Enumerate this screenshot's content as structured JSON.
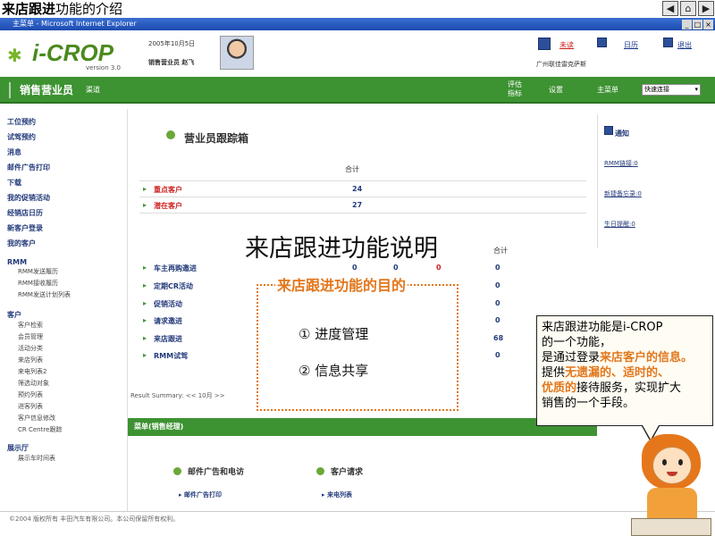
{
  "slide": {
    "title_bold": "来店跟进",
    "title_rest": "功能的介绍",
    "nav_buttons": [
      "◀",
      "⌂",
      "▶"
    ]
  },
  "window": {
    "title": "主菜单 - Microsoft Internet Explorer",
    "controls": [
      "_",
      "□",
      "×"
    ]
  },
  "header": {
    "logo_text": "i-CROP",
    "version": "version 3.0",
    "date": "2005年10月5日",
    "user": "销售营业员 赵飞",
    "links": [
      {
        "label": "未读",
        "icon": "calendar-icon"
      },
      {
        "label": "日历",
        "icon": "calendar-icon"
      },
      {
        "label": "退出",
        "icon": "logout-icon"
      }
    ],
    "dealer": "广州联佳雷克萨斯"
  },
  "navbar": {
    "title": "销售营业员",
    "subtitle": "渠道",
    "items": [
      "评估指标",
      "设置",
      "主菜单"
    ],
    "quick_select": "快速连接"
  },
  "sidebar": {
    "items": [
      "工位预约",
      "试驾预约",
      "消息",
      "邮件广告打印",
      "下载",
      "我的促销活动",
      "经销店日历",
      "新客户登录",
      "我的客户"
    ],
    "rmm_head": "RMM",
    "rmm_items": [
      "RMM发送履历",
      "RMM接收履历",
      "RMM发送计划列表"
    ],
    "customer_head": "客户",
    "customer_items": [
      "客户检索",
      "会员管理",
      "活动分类",
      "来店列表",
      "来电列表2",
      "筛选动对象",
      "预约列表",
      "进客列表",
      "客户信息修改",
      "CR Centre跟踪"
    ],
    "showroom_head": "展示厅",
    "showroom_items": [
      "展示车时间表"
    ]
  },
  "main": {
    "section_title": "营业员跟踪箱",
    "total_label": "合计",
    "rows_top": [
      {
        "label": "重点客户",
        "value": "24"
      },
      {
        "label": "潜在客户",
        "value": "27"
      }
    ],
    "total_label2": "合计",
    "rows_bottom": [
      {
        "label": "车主再购邀进",
        "v1": "0",
        "v2": "0",
        "v3": "0",
        "total": "0"
      },
      {
        "label": "定期CR活动",
        "total": "0"
      },
      {
        "label": "促销活动",
        "total": "0"
      },
      {
        "label": "请求邀进",
        "total": "0"
      },
      {
        "label": "来店跟进",
        "total": "68"
      },
      {
        "label": "RMM试驾",
        "total": "0"
      }
    ],
    "result_summary": "Result Summary:  <<  10月  >>",
    "menu_bar": "菜单(销售经理)",
    "section2_title": "邮件广告和电访",
    "section2_link": "邮件广告打印",
    "section3_title": "客户请求",
    "section3_link": "来电列表"
  },
  "notice": {
    "title": "通知",
    "links": [
      "RMM链接:0",
      "新捷备忘录:0",
      "生日提醒:0"
    ]
  },
  "overlay": {
    "title": "来店跟进功能说明",
    "purpose_title": "来店跟进功能的目的",
    "purposes": [
      "①  进度管理",
      "②  信息共享"
    ]
  },
  "callout": {
    "line1": "来店跟进功能是i-CROP",
    "line2": "的一个功能，",
    "line3a": "是通过登录",
    "line3b": "来店客户的信息。",
    "line4a": "提供",
    "line4b": "无遗漏的、适时的、",
    "line5a": "优质的",
    "line5b": "接待服务，实现扩大",
    "line6": "销售的一个手段。"
  },
  "footer": {
    "copyright": "©2004 版权所有 丰田汽车有限公司。本公司保留所有权利。"
  },
  "colors": {
    "green": "#3d9232",
    "accent_orange": "#e2771d",
    "link_blue": "#233a7a"
  }
}
